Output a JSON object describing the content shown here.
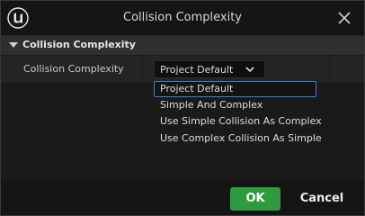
{
  "window": {
    "title": "Collision Complexity",
    "logo_icon": "unreal-engine-logo-icon",
    "close_icon": "close-icon"
  },
  "section": {
    "title": "Collision Complexity",
    "expanded": true
  },
  "property": {
    "label": "Collision Complexity",
    "selected_value": "Project Default"
  },
  "dropdown": {
    "options": [
      "Project Default",
      "Simple And Complex",
      "Use Simple Collision As Complex",
      "Use Complex Collision As Simple"
    ],
    "highlighted_index": 0
  },
  "footer": {
    "ok_label": "OK",
    "cancel_label": "Cancel"
  },
  "colors": {
    "accent_ok": "#2f9a3f",
    "selection_border": "#3f7fd6"
  }
}
